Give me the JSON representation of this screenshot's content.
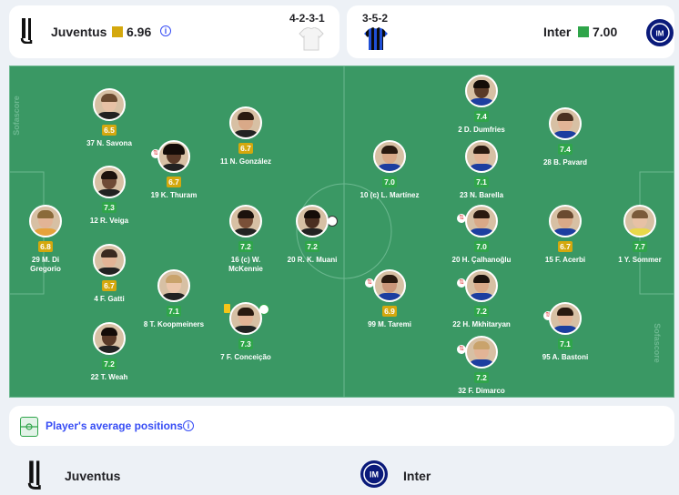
{
  "home": {
    "name": "Juventus",
    "rating": "6.96",
    "formation": "4-2-3-1",
    "rating_color": "#d4a80d"
  },
  "away": {
    "name": "Inter",
    "rating": "7.00",
    "formation": "3-5-2",
    "rating_color": "#2fa54a"
  },
  "home_players": [
    {
      "name": "29 M. Di Gregorio",
      "rating": "6.8",
      "tier": "mid",
      "sub": false
    },
    {
      "name": "37 N. Savona",
      "rating": "6.5",
      "tier": "mid",
      "sub": true
    },
    {
      "name": "12 R. Veiga",
      "rating": "7.3",
      "tier": "good",
      "sub": false
    },
    {
      "name": "4 F. Gatti",
      "rating": "6.7",
      "tier": "mid",
      "sub": false
    },
    {
      "name": "22 T. Weah",
      "rating": "7.2",
      "tier": "good",
      "sub": false
    },
    {
      "name": "19 K. Thuram",
      "rating": "6.7",
      "tier": "mid",
      "sub": true
    },
    {
      "name": "8 T. Koopmeiners",
      "rating": "7.1",
      "tier": "good",
      "sub": false
    },
    {
      "name": "11 N. González",
      "rating": "6.7",
      "tier": "mid",
      "sub": false
    },
    {
      "name": "16 (c) W. McKennie",
      "rating": "7.2",
      "tier": "good",
      "sub": false
    },
    {
      "name": "7 F. Conceição",
      "rating": "7.3",
      "tier": "good",
      "sub": false
    },
    {
      "name": "20 R. K. Muani",
      "rating": "7.2",
      "tier": "good",
      "sub": false
    }
  ],
  "away_players": [
    {
      "name": "1 Y. Sommer",
      "rating": "7.7",
      "tier": "good",
      "sub": false
    },
    {
      "name": "28 B. Pavard",
      "rating": "7.4",
      "tier": "good",
      "sub": false
    },
    {
      "name": "15 F. Acerbi",
      "rating": "6.7",
      "tier": "mid",
      "sub": false
    },
    {
      "name": "95 A. Bastoni",
      "rating": "7.1",
      "tier": "good",
      "sub": true
    },
    {
      "name": "2 D. Dumfries",
      "rating": "7.4",
      "tier": "good",
      "sub": false
    },
    {
      "name": "23 N. Barella",
      "rating": "7.1",
      "tier": "good",
      "sub": false
    },
    {
      "name": "20 H. Çalhanoğlu",
      "rating": "7.0",
      "tier": "good",
      "sub": true
    },
    {
      "name": "22 H. Mkhitaryan",
      "rating": "7.2",
      "tier": "good",
      "sub": true
    },
    {
      "name": "32 F. Dimarco",
      "rating": "7.2",
      "tier": "good",
      "sub": true
    },
    {
      "name": "10 (c) L. Martínez",
      "rating": "7.0",
      "tier": "good",
      "sub": false
    },
    {
      "name": "99 M. Taremi",
      "rating": "6.9",
      "tier": "mid",
      "sub": true
    }
  ],
  "avg_positions_label": "Player's average positions",
  "watermark": "Sofascore",
  "footer": {
    "home": "Juventus",
    "away": "Inter"
  }
}
